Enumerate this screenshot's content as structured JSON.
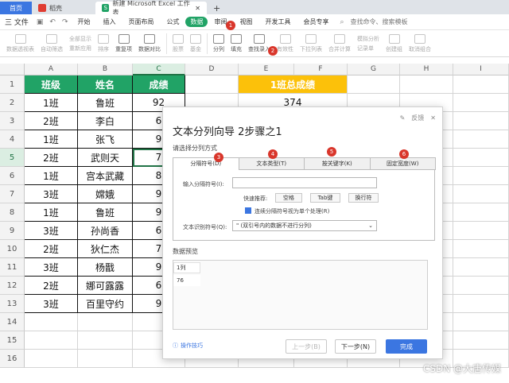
{
  "tabs": {
    "home": "首页",
    "docer": "稻壳",
    "doc": "新建 Microsoft Excel 工作表"
  },
  "menu": {
    "file": "三 文件",
    "items": [
      "开始",
      "插入",
      "页面布局",
      "公式",
      "数据",
      "审阅",
      "视图",
      "开发工具",
      "会员专享"
    ],
    "search": "查找命令、搜索模板"
  },
  "toolbar": {
    "pivot": "数据透视表",
    "autofilter": "自动筛选",
    "show_all": "全部显示",
    "reapply": "重新应用",
    "sort": "排序",
    "dup": "重复项",
    "compare": "数据对比",
    "stock": "股票",
    "fund": "基金",
    "split": "分列",
    "fill": "填充",
    "lookup": "查找录入",
    "valid": "有效性",
    "dropdown": "下拉列表",
    "consolidate": "合并计算",
    "simulate": "模拟分析",
    "record": "记录单",
    "group": "创建组",
    "ungroup": "取消组合"
  },
  "colors": {
    "accent": "#21a366",
    "gold": "#fcc10a",
    "badge": "#d9362b",
    "primary": "#3b76e1"
  },
  "columns": [
    "A",
    "B",
    "C",
    "D",
    "E",
    "F",
    "G",
    "H",
    "I"
  ],
  "rows": [
    "1",
    "2",
    "3",
    "4",
    "5",
    "6",
    "7",
    "8",
    "9",
    "10",
    "11",
    "12",
    "13",
    "14",
    "15",
    "16"
  ],
  "table": {
    "headers": [
      "班级",
      "姓名",
      "成绩"
    ],
    "rows": [
      [
        "1班",
        "鲁班",
        "92"
      ],
      [
        "2班",
        "李白",
        "6"
      ],
      [
        "1班",
        "张飞",
        "9"
      ],
      [
        "2班",
        "武则天",
        "7"
      ],
      [
        "1班",
        "宫本武藏",
        "8"
      ],
      [
        "3班",
        "嫦娥",
        "9"
      ],
      [
        "1班",
        "鲁班",
        "9"
      ],
      [
        "3班",
        "孙尚香",
        "6"
      ],
      [
        "2班",
        "狄仁杰",
        "7"
      ],
      [
        "3班",
        "杨戬",
        "9"
      ],
      [
        "2班",
        "娜可露露",
        "6"
      ],
      [
        "3班",
        "百里守约",
        "9"
      ]
    ]
  },
  "summary": {
    "header": "1班总成绩",
    "value": "374"
  },
  "dialog": {
    "title": "文本分列向导 2步骤之1",
    "feedback": "反馈",
    "subtitle": "请选择分列方式",
    "tabs": [
      "分隔符号(D)",
      "文本类型(T)",
      "按关键字(K)",
      "固定宽度(W)"
    ],
    "sep_label": "输入分隔符号(I):",
    "quick_label": "快速推荐:",
    "quick": [
      "空格",
      "Tab键",
      "换行符"
    ],
    "treat_consecutive": "连续分隔符号视为单个处理(R)",
    "qualifier_label": "文本识别符号(Q):",
    "qualifier_value": "\" (双引号内的数据不进行分列)",
    "preview_label": "数据预览",
    "preview_col": "1列",
    "preview_val": "76",
    "tips": "操作技巧",
    "prev": "上一步(B)",
    "next": "下一步(N)",
    "finish": "完成"
  },
  "badges": [
    "1",
    "2",
    "3",
    "4",
    "5",
    "6"
  ],
  "watermark": "CSDN @大唐传媒"
}
